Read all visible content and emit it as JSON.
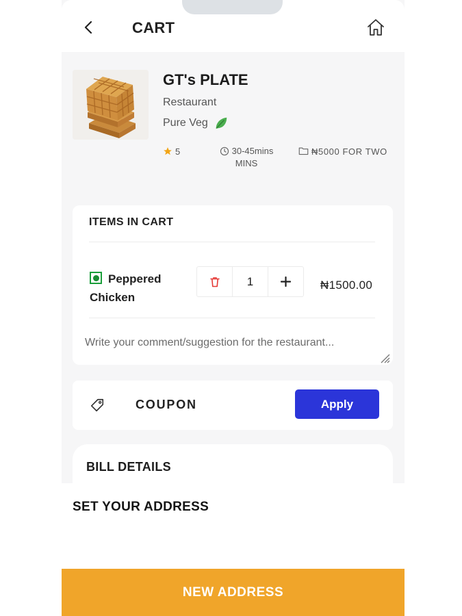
{
  "header": {
    "title": "CART",
    "back_icon": "chevron-left-icon",
    "home_icon": "home-icon"
  },
  "restaurant": {
    "name": "GT's PLATE",
    "type": "Restaurant",
    "diet": "Pure Veg",
    "rating": "5",
    "time_line1": "30-45mins",
    "time_line2": "MINS",
    "cost": "₦5000 FOR TWO"
  },
  "cart": {
    "section_title": "ITEMS IN CART",
    "items": [
      {
        "name": "Peppered Chicken",
        "quantity": "1",
        "price": "₦1500.00"
      }
    ],
    "comment_placeholder": "Write your comment/suggestion for the restaurant..."
  },
  "coupon": {
    "label": "COUPON",
    "apply_label": "Apply"
  },
  "bill": {
    "title": "BILL DETAILS"
  },
  "address": {
    "title": "SET YOUR ADDRESS",
    "button_label": "NEW ADDRESS"
  },
  "colors": {
    "primary_button": "#2b35d9",
    "address_button": "#f0a52a",
    "veg_green": "#1a9e3a",
    "delete_red": "#e53935",
    "star": "#f2a516"
  }
}
